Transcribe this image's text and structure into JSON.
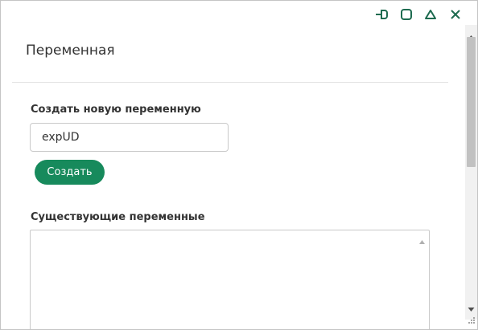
{
  "window": {
    "controls": [
      {
        "name": "dock-icon"
      },
      {
        "name": "maximize-icon"
      },
      {
        "name": "collapse-icon"
      },
      {
        "name": "close-icon"
      }
    ],
    "accent_color": "#178a5c",
    "icon_color": "#1e6b50"
  },
  "dialog": {
    "title": "Переменная",
    "new_variable": {
      "label": "Создать новую переменную",
      "input_value": "expUD",
      "button_label": "Создать"
    },
    "existing_variables": {
      "label": "Существующие переменные",
      "items": []
    }
  }
}
